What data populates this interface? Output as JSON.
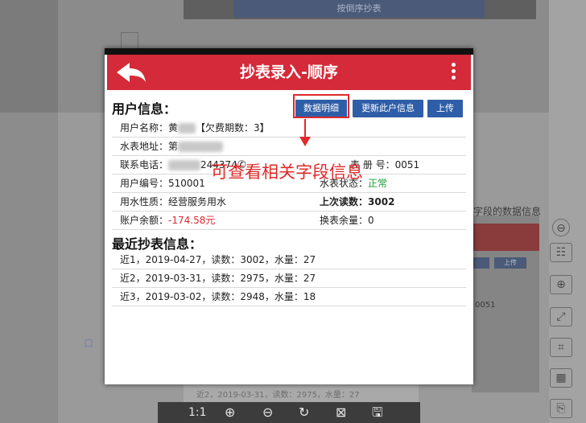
{
  "background": {
    "top_button_label": "按倒序抄表",
    "side_text": "字段的数据信息",
    "side_text_2": "0051",
    "mini_buttons": [
      "",
      "上传"
    ],
    "bottom_row": "近2，2019-03-31，读数：2975，水量：27",
    "left_marks": [
      "口",
      "口",
      "口"
    ],
    "viewer_toolbar": {
      "scale_label": "1:1",
      "zoom_in": "⊕",
      "zoom_out": "⊖",
      "rotate": "↻",
      "close": "⊠",
      "save": "🖫"
    },
    "side_tools": [
      "⊖",
      "☷",
      "⊕",
      "⤢",
      "⌗",
      "▦",
      "⎘"
    ]
  },
  "app": {
    "title": "抄表录入-顺序",
    "colors": {
      "header": "#d42a39",
      "button": "#2f5ea8",
      "warn": "#e0282f",
      "ok": "#1f9a3a",
      "annotation": "#e02a2a"
    }
  },
  "user_info": {
    "heading": "用户信息：",
    "buttons": {
      "detail": "数据明细",
      "update": "更新此户信息",
      "upload": "上传"
    },
    "name_label": "用户名称：",
    "name_value_visible": "黄",
    "name_suffix": "【欠费期数：3】",
    "address_label": "水表地址：",
    "address_value_visible": "第",
    "phone_label": "联系电话：",
    "phone_value_visible": "244374",
    "book_label": "表 册 号：",
    "book_value": "0051",
    "user_no_label": "用户编号：",
    "user_no_value": "510001",
    "meter_status_label": "水表状态：",
    "meter_status_value": "正常",
    "usage_type_label": "用水性质：",
    "usage_type_value": "经营服务用水",
    "last_reading_label": "上次读数：",
    "last_reading_value": "3002",
    "balance_label": "账户余额：",
    "balance_value": "-174.58元",
    "meter_remain_label": "换表余量：",
    "meter_remain_value": "0"
  },
  "recent": {
    "heading": "最近抄表信息：",
    "rows": [
      "近1，2019-04-27，读数：3002，水量：27",
      "近2，2019-03-31，读数：2975，水量：27",
      "近3，2019-03-02，读数：2948，水量：18"
    ]
  },
  "annotation": {
    "text": "可查看相关字段信息"
  }
}
